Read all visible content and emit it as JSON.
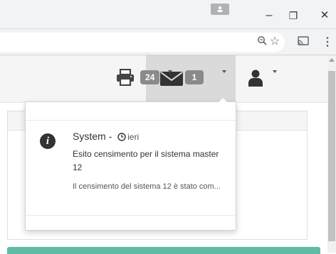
{
  "browser": {
    "minimize_glyph": "–",
    "maximize_glyph": "❐",
    "close_glyph": "✕",
    "zoom_icon": "zoom-icon",
    "bookmark_glyph": "☆",
    "cast_icon": "cast-icon",
    "menu_glyph": "⋮"
  },
  "header": {
    "print_badge": "24",
    "mail_badge": "1"
  },
  "notification": {
    "sender": "System - ",
    "time": "ieri",
    "subject": "Esito censimento per il sistema master 12",
    "preview": "Il censimento del sistema 12 è stato com..."
  },
  "colors": {
    "accent_green": "#61bba4",
    "badge_gray": "#8a8a8a"
  }
}
